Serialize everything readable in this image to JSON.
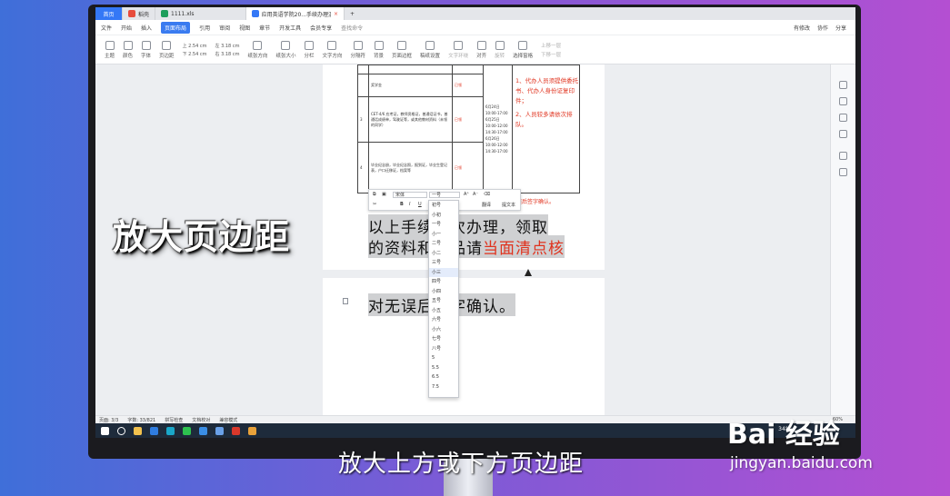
{
  "tabs": [
    {
      "label": "首页",
      "type": "home"
    },
    {
      "label": "稻壳",
      "color": "#e74c3c"
    },
    {
      "label": "1111.xls",
      "color": "#1e9e5c"
    },
    {
      "label": "应用英语学院20...手续办理温馨提示",
      "color": "#3478f6",
      "active": true
    }
  ],
  "menu": {
    "file": "文件",
    "items": [
      "开始",
      "插入",
      "页面布局",
      "引用",
      "审阅",
      "视图",
      "章节",
      "开发工具",
      "会员专享"
    ],
    "active": "页面布局",
    "search": "查找命令",
    "right": [
      "有修改",
      "协作",
      "分享"
    ]
  },
  "ribbon": {
    "items": [
      "主题",
      "颜色",
      "字体",
      "效果",
      "页边距",
      "纸张方向",
      "纸张大小",
      "分栏",
      "文字方向",
      "分隔符",
      "行号",
      "背景",
      "页面边框",
      "稿纸设置",
      "文字环绕",
      "对齐",
      "旋转",
      "选择窗格",
      "上移一层",
      "下移一层"
    ],
    "margin_top": "2.54 cm",
    "margin_bottom": "2.54 cm",
    "margin_left": "3.18 cm",
    "margin_right": "3.18 cm"
  },
  "doc": {
    "rows": [
      {
        "no": "",
        "text": "",
        "fee": ""
      },
      {
        "no": "",
        "text": "奖学金",
        "fee": "已领"
      },
      {
        "no": "3",
        "text": "CET-4/6 应考证，教师资格证，普通话证书，普通话成绩单，驾驶证等，或其他教材资料（未领的同学）",
        "fee": "已领"
      },
      {
        "no": "4",
        "text": "毕业纪念册，毕业纪念照，报到证，毕业生登记表，户口迁移证，档案等",
        "fee": "已领"
      }
    ],
    "dates": "6月24日 10:00-17:00 6月25日 10:00-12:00 14:30-17:00 6月26日 10:00-12:00 14:30-17:00",
    "notes": [
      "1、代办人员须提供委托书、代办人身份证复印件；",
      "2、人员较多请依次排队。"
    ],
    "inline_confirm": "误后签字确认。",
    "line1": "以上手续依次办理，领取",
    "line2a": "的资料和物品请",
    "line2b": "当面清点核",
    "line3": "对无误后签字确认。"
  },
  "mini_toolbar": {
    "font": "宋体",
    "size": "一号",
    "translate": "翻译",
    "text_label": "提文本"
  },
  "font_sizes": [
    "初号",
    "小初",
    "一号",
    "小一",
    "二号",
    "小二",
    "三号",
    "小三",
    "四号",
    "小四",
    "五号",
    "小五",
    "六号",
    "小六",
    "七号",
    "八号",
    "5",
    "5.5",
    "6.5",
    "7.5"
  ],
  "hover_size": "小三",
  "status": {
    "page": "页面: 3/3",
    "words": "字数: 33/821",
    "spell": "拼写检查",
    "doc_check": "文档校对",
    "protect": "兼容模式",
    "zoom": "60%"
  },
  "taskbar": {
    "temp": "34°C"
  },
  "overlay": {
    "big": "放大页边距",
    "subtitle": "放大上方或下方页边距",
    "logo": "Bai 经验",
    "url": "jingyan.baidu.com"
  }
}
